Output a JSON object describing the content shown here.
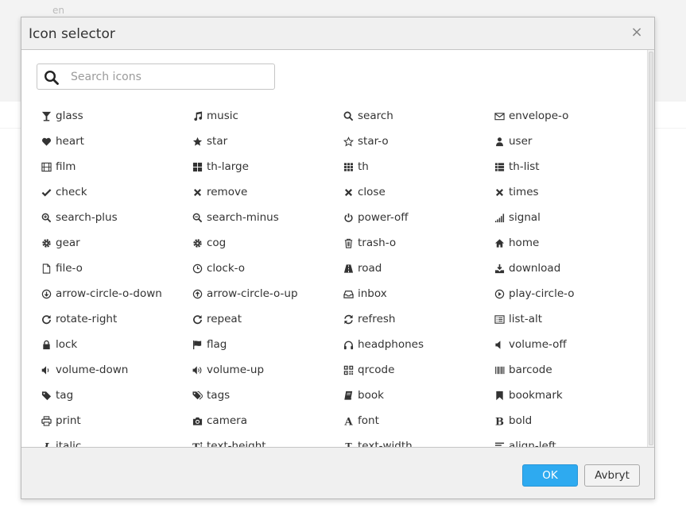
{
  "background": {
    "lang": "en"
  },
  "dialog": {
    "title": "Icon selector",
    "close_glyph": "×",
    "search": {
      "placeholder": "Search icons",
      "value": ""
    },
    "ok_label": "OK",
    "cancel_label": "Avbryt",
    "accent_color": "#2eaaf0",
    "icons": [
      {
        "icon": "glass",
        "label": "glass"
      },
      {
        "icon": "music",
        "label": "music"
      },
      {
        "icon": "search",
        "label": "search"
      },
      {
        "icon": "envelope-o",
        "label": "envelope-o"
      },
      {
        "icon": "heart",
        "label": "heart"
      },
      {
        "icon": "star",
        "label": "star"
      },
      {
        "icon": "star-o",
        "label": "star-o"
      },
      {
        "icon": "user",
        "label": "user"
      },
      {
        "icon": "film",
        "label": "film"
      },
      {
        "icon": "th-large",
        "label": "th-large"
      },
      {
        "icon": "th",
        "label": "th"
      },
      {
        "icon": "th-list",
        "label": "th-list"
      },
      {
        "icon": "check",
        "label": "check"
      },
      {
        "icon": "remove",
        "label": "remove"
      },
      {
        "icon": "close",
        "label": "close"
      },
      {
        "icon": "times",
        "label": "times"
      },
      {
        "icon": "search-plus",
        "label": "search-plus"
      },
      {
        "icon": "search-minus",
        "label": "search-minus"
      },
      {
        "icon": "power-off",
        "label": "power-off"
      },
      {
        "icon": "signal",
        "label": "signal"
      },
      {
        "icon": "gear",
        "label": "gear"
      },
      {
        "icon": "cog",
        "label": "cog"
      },
      {
        "icon": "trash-o",
        "label": "trash-o"
      },
      {
        "icon": "home",
        "label": "home"
      },
      {
        "icon": "file-o",
        "label": "file-o"
      },
      {
        "icon": "clock-o",
        "label": "clock-o"
      },
      {
        "icon": "road",
        "label": "road"
      },
      {
        "icon": "download",
        "label": "download"
      },
      {
        "icon": "arrow-circle-o-down",
        "label": "arrow-circle-o-down"
      },
      {
        "icon": "arrow-circle-o-up",
        "label": "arrow-circle-o-up"
      },
      {
        "icon": "inbox",
        "label": "inbox"
      },
      {
        "icon": "play-circle-o",
        "label": "play-circle-o"
      },
      {
        "icon": "rotate-right",
        "label": "rotate-right"
      },
      {
        "icon": "repeat",
        "label": "repeat"
      },
      {
        "icon": "refresh",
        "label": "refresh"
      },
      {
        "icon": "list-alt",
        "label": "list-alt"
      },
      {
        "icon": "lock",
        "label": "lock"
      },
      {
        "icon": "flag",
        "label": "flag"
      },
      {
        "icon": "headphones",
        "label": "headphones"
      },
      {
        "icon": "volume-off",
        "label": "volume-off"
      },
      {
        "icon": "volume-down",
        "label": "volume-down"
      },
      {
        "icon": "volume-up",
        "label": "volume-up"
      },
      {
        "icon": "qrcode",
        "label": "qrcode"
      },
      {
        "icon": "barcode",
        "label": "barcode"
      },
      {
        "icon": "tag",
        "label": "tag"
      },
      {
        "icon": "tags",
        "label": "tags"
      },
      {
        "icon": "book",
        "label": "book"
      },
      {
        "icon": "bookmark",
        "label": "bookmark"
      },
      {
        "icon": "print",
        "label": "print"
      },
      {
        "icon": "camera",
        "label": "camera"
      },
      {
        "icon": "font",
        "label": "font"
      },
      {
        "icon": "bold",
        "label": "bold"
      },
      {
        "icon": "italic",
        "label": "italic"
      },
      {
        "icon": "text-height",
        "label": "text-height"
      },
      {
        "icon": "text-width",
        "label": "text-width"
      },
      {
        "icon": "align-left",
        "label": "align-left"
      }
    ]
  }
}
